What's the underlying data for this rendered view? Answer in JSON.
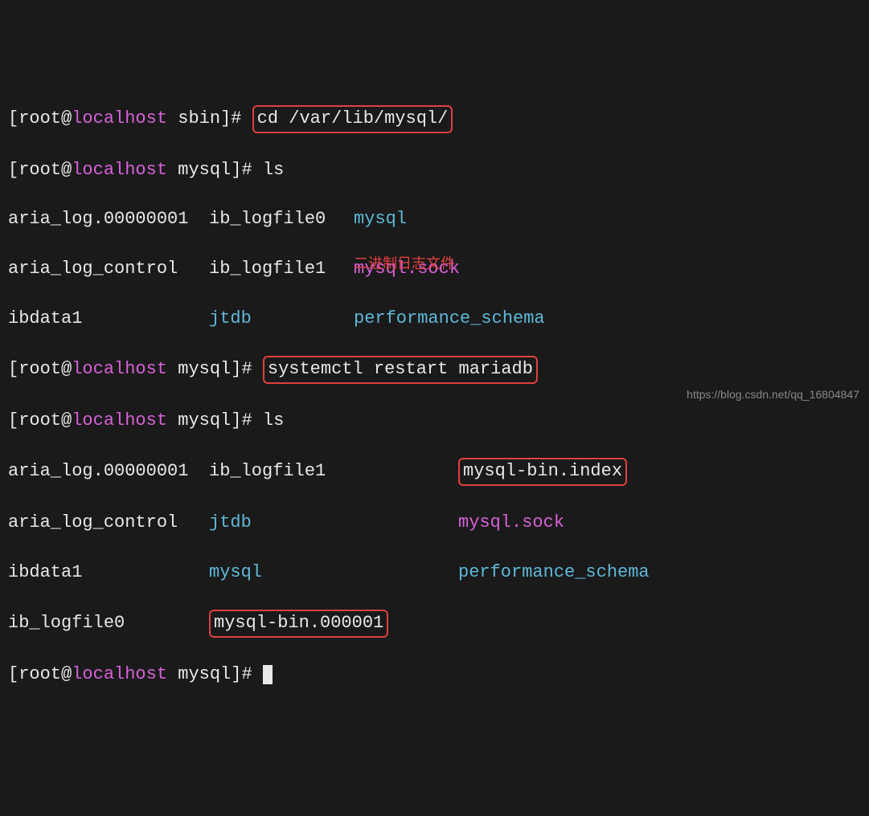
{
  "prompt": {
    "open": "[",
    "user": "root",
    "at": "@",
    "host": "localhost",
    "dir1": "sbin",
    "dir2": "mysql",
    "close": "]#"
  },
  "commands": {
    "cd": "cd /var/lib/mysql/",
    "ls1": "ls",
    "restart": "systemctl restart mariadb",
    "ls2": "ls"
  },
  "listing1": {
    "r1": {
      "c1": "aria_log.00000001",
      "c2": "ib_logfile0",
      "c3": "mysql"
    },
    "r2": {
      "c1": "aria_log_control",
      "c2": "ib_logfile1",
      "c3": "mysql.sock"
    },
    "r3": {
      "c1": "ibdata1",
      "c2": "jtdb",
      "c3": "performance_schema"
    }
  },
  "listing2": {
    "r1": {
      "c1": "aria_log.00000001",
      "c2": "ib_logfile1",
      "c3": "mysql-bin.index"
    },
    "r2": {
      "c1": "aria_log_control",
      "c2": "jtdb",
      "c3": "mysql.sock"
    },
    "r3": {
      "c1": "ibdata1",
      "c2": "mysql",
      "c3": "performance_schema"
    },
    "r4": {
      "c1": "ib_logfile0",
      "c2": "mysql-bin.000001"
    }
  },
  "annotation": "二进制日志文件",
  "watermark": "https://blog.csdn.net/qq_16804847"
}
